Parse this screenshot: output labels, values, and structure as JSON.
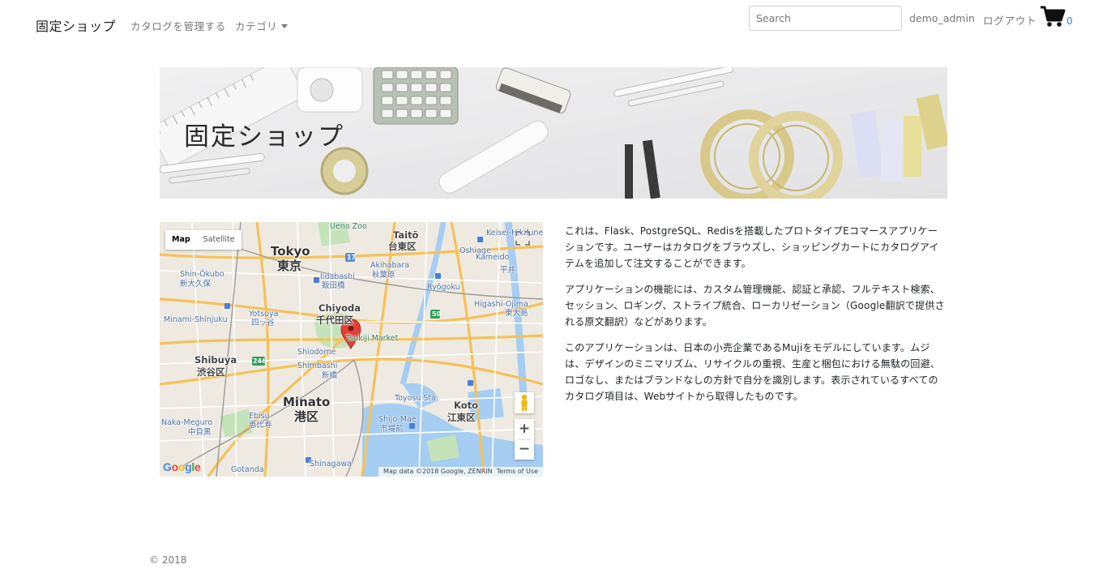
{
  "navbar": {
    "brand": "固定ショップ",
    "manage_catalog": "カタログを管理する",
    "category": "カテゴリ",
    "search_placeholder": "Search",
    "username": "demo_admin",
    "logout": "ログアウト",
    "cart_count": "0",
    "cart_icon": "shopping-cart-icon"
  },
  "hero": {
    "title": "固定ショップ"
  },
  "map": {
    "type_map": "Map",
    "type_satellite": "Satellite",
    "google_logo": "Google",
    "attribution": "Map data ©2018 Google, ZENRIN",
    "terms": "Terms of Use",
    "labels": {
      "tokyo_en": "Tokyo",
      "tokyo_jp": "東京",
      "chiyoda_en": "Chiyoda",
      "chiyoda_jp": "千代田区",
      "shibuya_en": "Shibuya",
      "shibuya_jp": "渋谷区",
      "minato_en": "Minato",
      "minato_jp": "港区",
      "koto_en": "Koto",
      "koto_jp": "江東区",
      "taito_en": "Taitō",
      "taito_jp": "台東区",
      "ueno": "Ueno Zoo",
      "akihabara_en": "Akihabara",
      "akihabara_jp": "秋葉原",
      "iidabashi_en": "Iidabashi",
      "iidabashi_jp": "飯田橋",
      "ryogoku": "Ryōgoku",
      "shinokubo_en": "Shin-Ōkubo",
      "shinokubo_jp": "新大久保",
      "yotsuya_en": "Yotsuya",
      "yotsuya_jp": "四ッ谷",
      "shimbashi_en": "Shimbashi",
      "shimbashi_jp": "新橋",
      "tsukiji": "Tsukiji Market",
      "toyosu": "Toyosu Sta.",
      "shijomae_en": "Shijo-Mae",
      "shijomae_jp": "市場前",
      "ebisu_en": "Ebisu",
      "ebisu_jp": "恵比寿",
      "nakameguro_en": "Naka-Meguro",
      "nakameguro_jp": "中目黒",
      "shinagawa": "Shinagawa",
      "gotanda": "Gotanda",
      "higashiojima_en": "Higashi-Ojima",
      "higashiojima_jp": "東大島",
      "hirai": "平井",
      "oshiage": "Oshiage",
      "keisei": "Keisei-Hikifune",
      "kameido": "Kameido",
      "shiodome": "Shiodome",
      "minamishinjuku": "Minami-Shinjuku"
    }
  },
  "description": {
    "p1": "これは、Flask、PostgreSQL、Redisを搭載したプロトタイプEコマースアプリケーションです。ユーザーはカタログをブラウズし、ショッピングカートにカタログアイテムを追加して注文することができます。",
    "p2": "アプリケーションの機能には、カスタム管理機能、認証と承認、フルテキスト検索、セッション、ロギング、ストライプ統合、ローカリゼーション（Google翻訳で提供される原文翻訳）などがあります。",
    "p3": "このアプリケーションは、日本の小売企業であるMujiをモデルにしています。ムジは、デザインのミニマリズム、リサイクルの重視、生産と梱包における無駄の回避、ロゴなし、またはブランドなしの方針で自分を識別します。表示されているすべてのカタログ項目は、Webサイトから取得したものです。"
  },
  "footer": {
    "copyright": "© 2018"
  }
}
